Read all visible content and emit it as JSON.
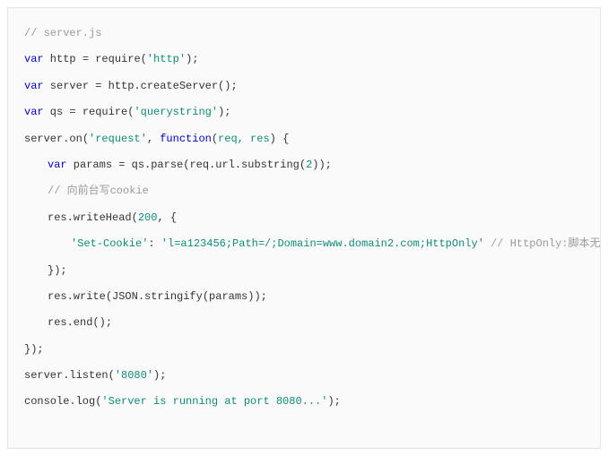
{
  "code": {
    "lines": [
      {
        "indent": 0,
        "parts": [
          {
            "cls": "tok-comment",
            "t": "// server.js"
          }
        ]
      },
      {
        "indent": 0,
        "parts": [
          {
            "cls": "tok-kw",
            "t": "var"
          },
          {
            "cls": "tok-ident",
            "t": " http "
          },
          {
            "cls": "tok-punct",
            "t": "= "
          },
          {
            "cls": "tok-ident",
            "t": "require"
          },
          {
            "cls": "tok-punct",
            "t": "("
          },
          {
            "cls": "tok-str",
            "t": "'http'"
          },
          {
            "cls": "tok-punct",
            "t": ");"
          }
        ]
      },
      {
        "indent": 0,
        "parts": [
          {
            "cls": "tok-kw",
            "t": "var"
          },
          {
            "cls": "tok-ident",
            "t": " server "
          },
          {
            "cls": "tok-punct",
            "t": "= "
          },
          {
            "cls": "tok-ident",
            "t": "http.createServer"
          },
          {
            "cls": "tok-punct",
            "t": "();"
          }
        ]
      },
      {
        "indent": 0,
        "parts": [
          {
            "cls": "tok-kw",
            "t": "var"
          },
          {
            "cls": "tok-ident",
            "t": " qs "
          },
          {
            "cls": "tok-punct",
            "t": "= "
          },
          {
            "cls": "tok-ident",
            "t": "require"
          },
          {
            "cls": "tok-punct",
            "t": "("
          },
          {
            "cls": "tok-str",
            "t": "'querystring'"
          },
          {
            "cls": "tok-punct",
            "t": ");"
          }
        ]
      },
      {
        "indent": 0,
        "parts": [
          {
            "cls": "tok-ident",
            "t": "server.on"
          },
          {
            "cls": "tok-punct",
            "t": "("
          },
          {
            "cls": "tok-str",
            "t": "'request'"
          },
          {
            "cls": "tok-punct",
            "t": ", "
          },
          {
            "cls": "tok-fn",
            "t": "function"
          },
          {
            "cls": "tok-punct",
            "t": "("
          },
          {
            "cls": "tok-param",
            "t": "req, res"
          },
          {
            "cls": "tok-punct",
            "t": ")"
          },
          {
            "cls": "tok-ident",
            "t": " "
          },
          {
            "cls": "tok-punct",
            "t": "{"
          }
        ]
      },
      {
        "indent": 1,
        "parts": [
          {
            "cls": "tok-kw",
            "t": "var"
          },
          {
            "cls": "tok-ident",
            "t": " params "
          },
          {
            "cls": "tok-punct",
            "t": "= "
          },
          {
            "cls": "tok-ident",
            "t": "qs.parse"
          },
          {
            "cls": "tok-punct",
            "t": "("
          },
          {
            "cls": "tok-ident",
            "t": "req.url.substring"
          },
          {
            "cls": "tok-punct",
            "t": "("
          },
          {
            "cls": "tok-num",
            "t": "2"
          },
          {
            "cls": "tok-punct",
            "t": "));"
          }
        ]
      },
      {
        "indent": 1,
        "parts": [
          {
            "cls": "tok-comment",
            "t": "// 向前台写cookie"
          }
        ]
      },
      {
        "indent": 1,
        "parts": [
          {
            "cls": "tok-ident",
            "t": "res.writeHead"
          },
          {
            "cls": "tok-punct",
            "t": "("
          },
          {
            "cls": "tok-num",
            "t": "200"
          },
          {
            "cls": "tok-punct",
            "t": ", "
          },
          {
            "cls": "tok-ident",
            "t": " "
          },
          {
            "cls": "tok-punct",
            "t": "{"
          }
        ]
      },
      {
        "indent": 2,
        "parts": [
          {
            "cls": "tok-str",
            "t": "'Set-Cookie'"
          },
          {
            "cls": "tok-punct",
            "t": ": "
          },
          {
            "cls": "tok-str",
            "t": "'l=a123456;Path=/;Domain=www.domain2.com;HttpOnly'"
          },
          {
            "cls": "tok-ident",
            "t": "   "
          },
          {
            "cls": "tok-comment",
            "t": "// HttpOnly:脚本无法读取"
          }
        ]
      },
      {
        "indent": 1,
        "parts": [
          {
            "cls": "tok-punct",
            "t": "});"
          }
        ]
      },
      {
        "indent": 1,
        "parts": [
          {
            "cls": "tok-ident",
            "t": "res.write"
          },
          {
            "cls": "tok-punct",
            "t": "("
          },
          {
            "cls": "tok-ident",
            "t": "JSON.stringify"
          },
          {
            "cls": "tok-punct",
            "t": "("
          },
          {
            "cls": "tok-ident",
            "t": "params"
          },
          {
            "cls": "tok-punct",
            "t": "));"
          }
        ]
      },
      {
        "indent": 1,
        "parts": [
          {
            "cls": "tok-ident",
            "t": "res.end"
          },
          {
            "cls": "tok-punct",
            "t": "();"
          }
        ]
      },
      {
        "indent": 0,
        "parts": [
          {
            "cls": "tok-punct",
            "t": "});"
          }
        ]
      },
      {
        "indent": 0,
        "parts": [
          {
            "cls": "tok-ident",
            "t": "server.listen"
          },
          {
            "cls": "tok-punct",
            "t": "("
          },
          {
            "cls": "tok-str",
            "t": "'8080'"
          },
          {
            "cls": "tok-punct",
            "t": ");"
          }
        ]
      },
      {
        "indent": 0,
        "parts": [
          {
            "cls": "tok-ident",
            "t": "console.log"
          },
          {
            "cls": "tok-punct",
            "t": "("
          },
          {
            "cls": "tok-str",
            "t": "'Server is running at port 8080...'"
          },
          {
            "cls": "tok-punct",
            "t": ");"
          }
        ]
      }
    ]
  }
}
